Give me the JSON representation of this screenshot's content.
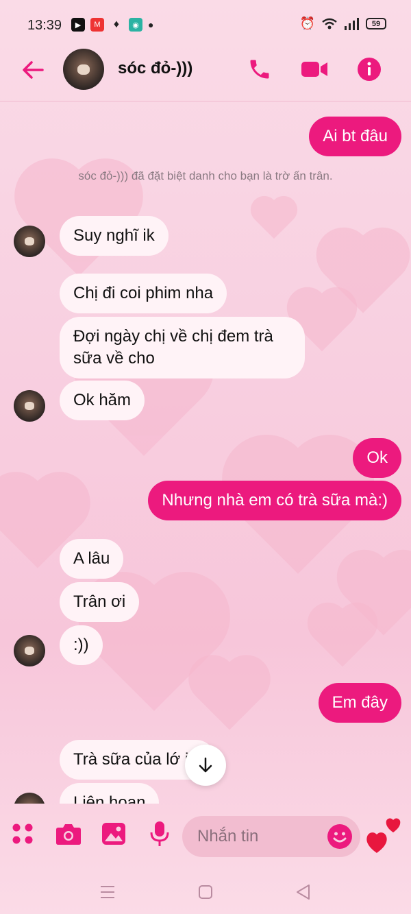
{
  "status_bar": {
    "time": "13:39",
    "battery": "59"
  },
  "header": {
    "contact_name": "sóc đỏ-)))",
    "icons": [
      "back-arrow-icon",
      "phone-icon",
      "video-icon",
      "info-icon"
    ]
  },
  "colors": {
    "accent": "#ec1a7e",
    "incoming_bubble": "#fff3f7"
  },
  "messages": [
    {
      "dir": "out",
      "text": "Ai bt đâu"
    },
    {
      "dir": "system",
      "text": "sóc đỏ-))) đã đặt biệt danh cho bạn là trờ ấn trân."
    },
    {
      "dir": "in",
      "text": "Suy nghĩ ik"
    },
    {
      "dir": "in",
      "text": "Chị đi coi phim nha"
    },
    {
      "dir": "in",
      "text": "Đợi ngày chị về chị đem trà sữa về cho"
    },
    {
      "dir": "in",
      "text": "Ok hăm"
    },
    {
      "dir": "out",
      "text": "Ok"
    },
    {
      "dir": "out",
      "text": "Nhưng nhà em có trà sữa mà:)"
    },
    {
      "dir": "in",
      "text": "A lâu"
    },
    {
      "dir": "in",
      "text": "Trân ơi"
    },
    {
      "dir": "in",
      "text": ":))"
    },
    {
      "dir": "out",
      "text": "Em đây"
    },
    {
      "dir": "in",
      "text": "Trà sữa của lớ  i á"
    },
    {
      "dir": "in",
      "text": "Liên hoan"
    }
  ],
  "composer": {
    "placeholder": "Nhắn tin",
    "icons": [
      "apps-grid-icon",
      "camera-icon",
      "image-icon",
      "microphone-icon",
      "emoji-icon",
      "heart-icon"
    ]
  }
}
